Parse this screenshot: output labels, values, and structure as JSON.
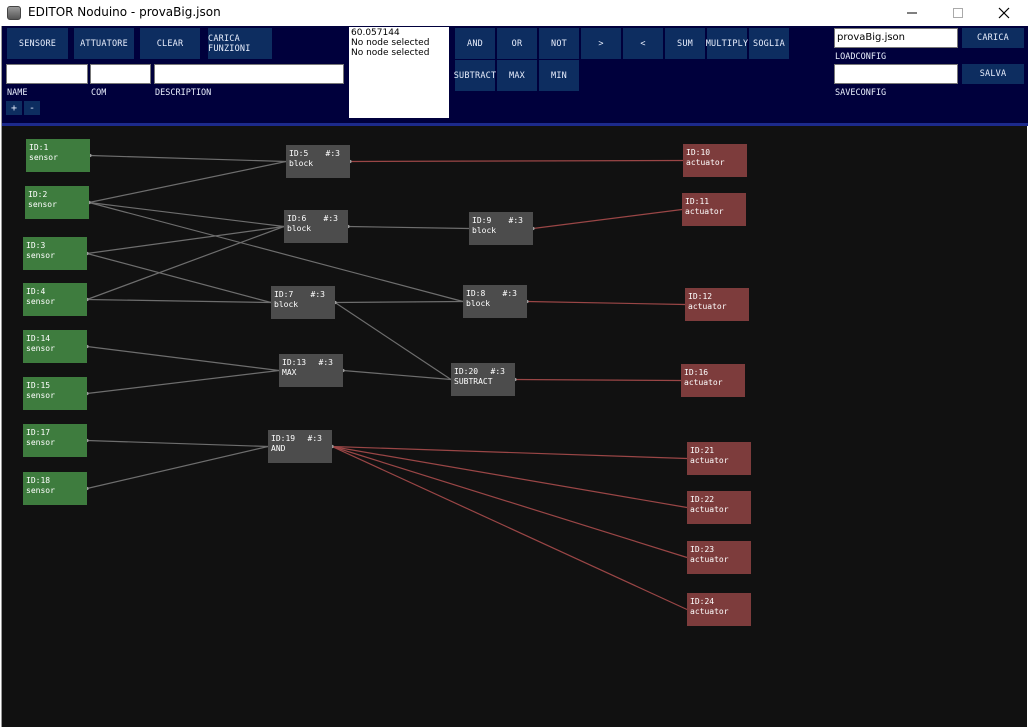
{
  "window": {
    "title": "EDITOR Noduino - provaBig.json"
  },
  "toolbar": {
    "sensore": "SENSORE",
    "attuatore": "ATTUATORE",
    "clear": "CLEAR",
    "carica_funzioni": "CARICA FUNZIONI",
    "name_label": "NAME",
    "com_label": "COM",
    "description_label": "DESCRIPTION",
    "name_value": "",
    "com_value": "",
    "description_value": "",
    "zoom_in": "+",
    "zoom_out": "-",
    "info_lines": [
      "60.057144",
      "No node selected",
      "No node selected"
    ],
    "ops": {
      "and": "AND",
      "or": "OR",
      "not": "NOT",
      "gt": ">",
      "lt": "<",
      "sum": "SUM",
      "multiply": "MULTIPLY",
      "soglia": "SOGLIA",
      "subtract": "SUBTRACT",
      "max": "MAX",
      "min": "MIN"
    },
    "load_value": "provaBig.json",
    "carica": "CARICA",
    "loadconfig_label": "LOADCONFIG",
    "save_value": "",
    "salva": "SALVA",
    "saveconfig_label": "SAVECONFIG"
  },
  "nodes": [
    {
      "id": "ID:1",
      "type": "sensor",
      "count": ""
    },
    {
      "id": "ID:2",
      "type": "sensor",
      "count": ""
    },
    {
      "id": "ID:3",
      "type": "sensor",
      "count": ""
    },
    {
      "id": "ID:4",
      "type": "sensor",
      "count": ""
    },
    {
      "id": "ID:14",
      "type": "sensor",
      "count": ""
    },
    {
      "id": "ID:15",
      "type": "sensor",
      "count": ""
    },
    {
      "id": "ID:17",
      "type": "sensor",
      "count": ""
    },
    {
      "id": "ID:18",
      "type": "sensor",
      "count": ""
    },
    {
      "id": "ID:5",
      "type": "block",
      "count": "#:3"
    },
    {
      "id": "ID:6",
      "type": "block",
      "count": "#:3"
    },
    {
      "id": "ID:7",
      "type": "block",
      "count": "#:3"
    },
    {
      "id": "ID:13",
      "type": "MAX",
      "count": "#:3"
    },
    {
      "id": "ID:19",
      "type": "AND",
      "count": "#:3"
    },
    {
      "id": "ID:9",
      "type": "block",
      "count": "#:3"
    },
    {
      "id": "ID:8",
      "type": "block",
      "count": "#:3"
    },
    {
      "id": "ID:20",
      "type": "SUBTRACT",
      "count": "#:3"
    },
    {
      "id": "ID:10",
      "type": "actuator",
      "count": ""
    },
    {
      "id": "ID:11",
      "type": "actuator",
      "count": ""
    },
    {
      "id": "ID:12",
      "type": "actuator",
      "count": ""
    },
    {
      "id": "ID:16",
      "type": "actuator",
      "count": ""
    },
    {
      "id": "ID:21",
      "type": "actuator",
      "count": ""
    },
    {
      "id": "ID:22",
      "type": "actuator",
      "count": ""
    },
    {
      "id": "ID:23",
      "type": "actuator",
      "count": ""
    },
    {
      "id": "ID:24",
      "type": "actuator",
      "count": ""
    }
  ],
  "connections": [
    [
      "ID:1",
      "ID:5"
    ],
    [
      "ID:2",
      "ID:5"
    ],
    [
      "ID:2",
      "ID:6"
    ],
    [
      "ID:2",
      "ID:8"
    ],
    [
      "ID:3",
      "ID:6"
    ],
    [
      "ID:3",
      "ID:7"
    ],
    [
      "ID:4",
      "ID:6"
    ],
    [
      "ID:4",
      "ID:7"
    ],
    [
      "ID:14",
      "ID:13"
    ],
    [
      "ID:15",
      "ID:13"
    ],
    [
      "ID:17",
      "ID:19"
    ],
    [
      "ID:18",
      "ID:19"
    ],
    [
      "ID:6",
      "ID:9"
    ],
    [
      "ID:7",
      "ID:8"
    ],
    [
      "ID:7",
      "ID:20"
    ],
    [
      "ID:13",
      "ID:20"
    ],
    [
      "ID:5",
      "ID:10"
    ],
    [
      "ID:9",
      "ID:11"
    ],
    [
      "ID:8",
      "ID:12"
    ],
    [
      "ID:20",
      "ID:16"
    ],
    [
      "ID:19",
      "ID:21"
    ],
    [
      "ID:19",
      "ID:22"
    ],
    [
      "ID:19",
      "ID:23"
    ],
    [
      "ID:19",
      "ID:24"
    ]
  ],
  "colors": {
    "sensor": "#3e7c3e",
    "block": "#4c4c4c",
    "actuator": "#7d3c3c",
    "wire_gray": "#6e6e6e",
    "wire_red": "#9a4646",
    "toolbar_bg": "#00003c",
    "button_bg": "#0d2d60",
    "canvas_bg": "#111111"
  }
}
